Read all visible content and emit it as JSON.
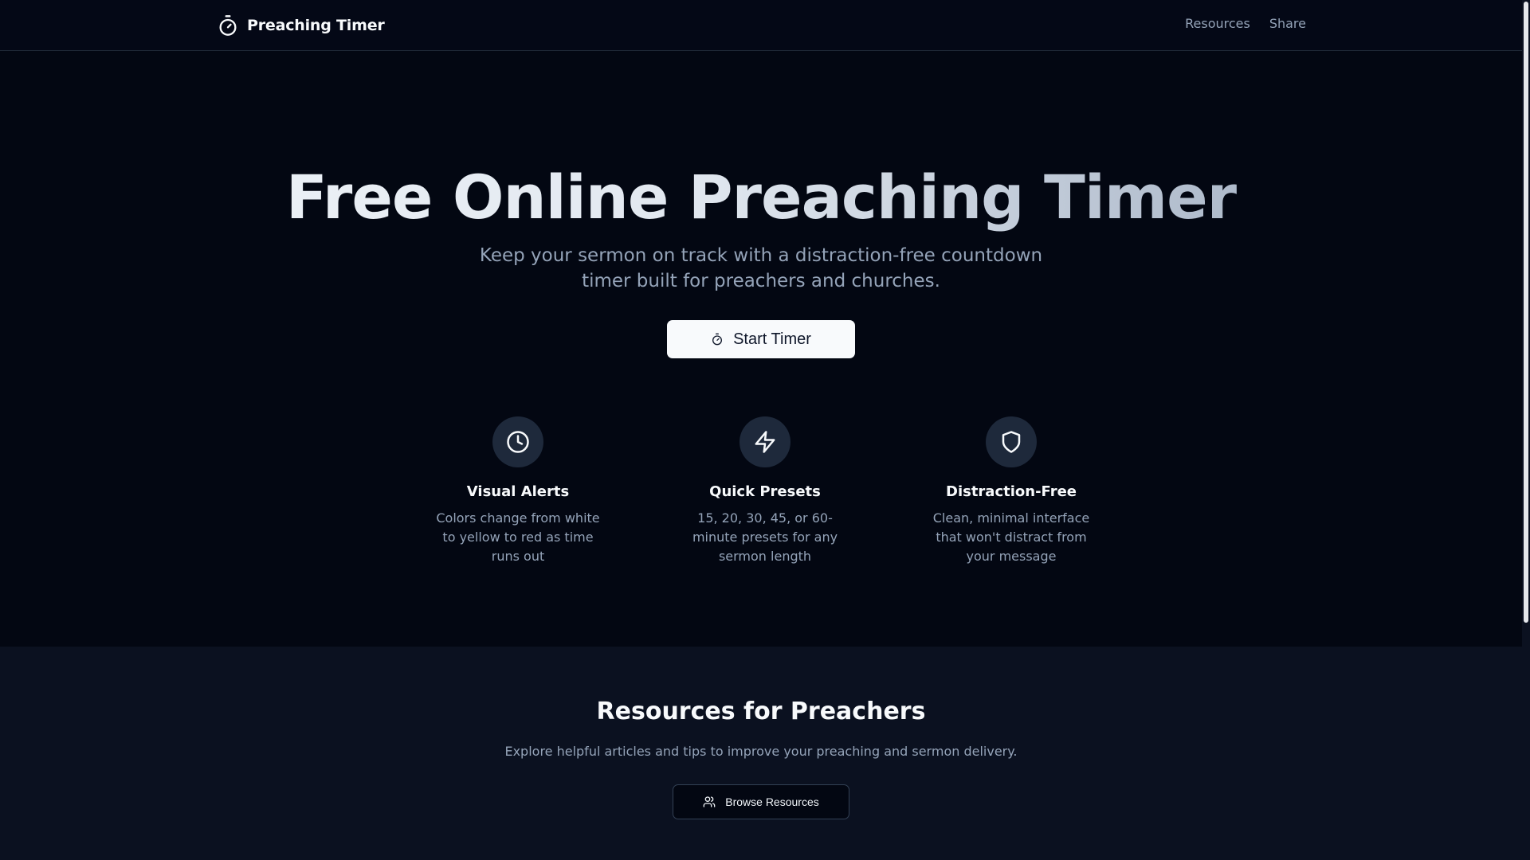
{
  "header": {
    "brand": "Preaching Timer",
    "brand_icon": "stopwatch-icon",
    "nav": [
      {
        "label": "Resources"
      },
      {
        "label": "Share"
      }
    ]
  },
  "hero": {
    "title": "Free Online Preaching Timer",
    "subtitle": "Keep your sermon on track with a distraction-free countdown timer built for preachers and churches.",
    "cta_label": "Start Timer",
    "cta_icon": "stopwatch-icon"
  },
  "features": [
    {
      "icon": "clock-icon",
      "title": "Visual Alerts",
      "description": "Colors change from white to yellow to red as time runs out"
    },
    {
      "icon": "lightning-icon",
      "title": "Quick Presets",
      "description": "15, 20, 30, 45, or 60-minute presets for any sermon length"
    },
    {
      "icon": "shield-icon",
      "title": "Distraction-Free",
      "description": "Clean, minimal interface that won't distract from your message"
    }
  ],
  "resources": {
    "title": "Resources for Preachers",
    "subtitle": "Explore helpful articles and tips to improve your preaching and sermon delivery.",
    "button_label": "Browse Resources",
    "button_icon": "users-icon"
  },
  "colors": {
    "background": "#030712",
    "section_background": "#0b1120",
    "text": "#f8fafc",
    "muted_text": "#94a3b8",
    "icon_circle": "#1e293b"
  }
}
